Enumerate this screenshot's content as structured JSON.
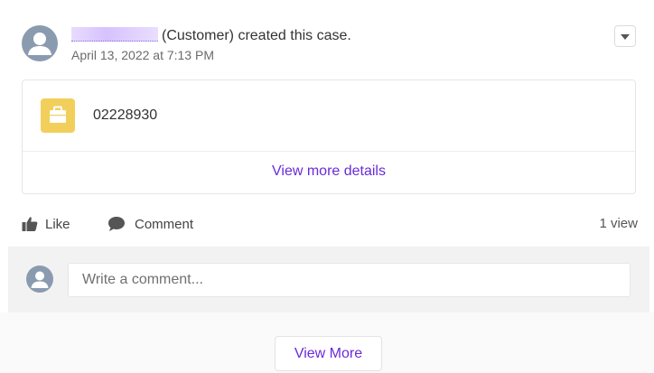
{
  "post": {
    "actor_role": "(Customer) created this case.",
    "timestamp": "April 13, 2022 at 7:13 PM",
    "menu_icon": "chevron-down-icon"
  },
  "case_card": {
    "icon": "case-briefcase-icon",
    "icon_color": "#f2cf5b",
    "case_number": "02228930",
    "view_details_label": "View more details"
  },
  "actions": {
    "like_label": "Like",
    "comment_label": "Comment",
    "views": "1 view"
  },
  "comment_box": {
    "placeholder": "Write a comment..."
  },
  "footer": {
    "view_more_label": "View More"
  },
  "colors": {
    "link": "#6a2bd9",
    "avatar": "#8a9bb0"
  }
}
